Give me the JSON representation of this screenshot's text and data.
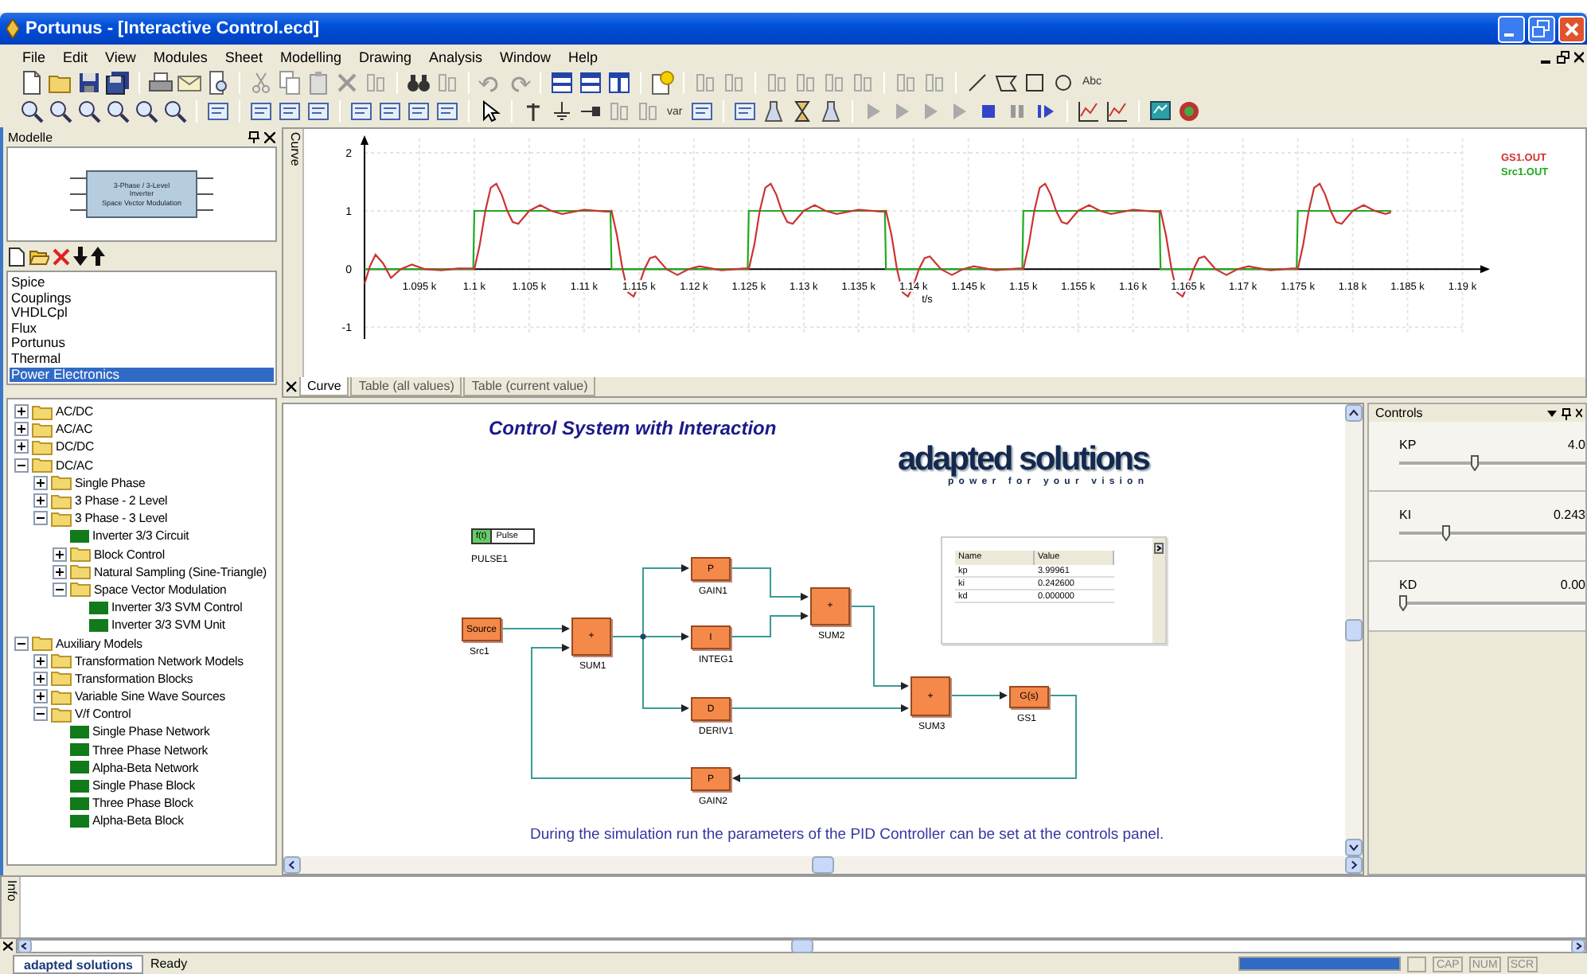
{
  "window": {
    "title": "Portunus - [Interactive Control.ecd]"
  },
  "menu": [
    "File",
    "Edit",
    "View",
    "Modules",
    "Sheet",
    "Modelling",
    "Drawing",
    "Analysis",
    "Window",
    "Help"
  ],
  "toolbar_texts": [
    "Abc",
    "var"
  ],
  "models_panel": {
    "title": "Modelle",
    "preview_lines": [
      "3-Phase / 3-Level",
      "Inverter",
      "Space Vector Modulation"
    ],
    "libraries": [
      {
        "label": "Spice",
        "selected": false
      },
      {
        "label": "Couplings",
        "selected": false
      },
      {
        "label": "VHDLCpl",
        "selected": false
      },
      {
        "label": "Flux",
        "selected": false
      },
      {
        "label": "Portunus",
        "selected": false
      },
      {
        "label": "Thermal",
        "selected": false
      },
      {
        "label": "Power Electronics",
        "selected": true
      }
    ]
  },
  "tree": [
    {
      "label": "AC/DC",
      "kind": "folder",
      "expanded": false
    },
    {
      "label": "AC/AC",
      "kind": "folder",
      "expanded": false
    },
    {
      "label": "DC/DC",
      "kind": "folder",
      "expanded": false
    },
    {
      "label": "DC/AC",
      "kind": "folder",
      "expanded": true,
      "children": [
        {
          "label": "Single Phase",
          "kind": "folder",
          "expanded": false
        },
        {
          "label": "3 Phase - 2 Level",
          "kind": "folder",
          "expanded": false
        },
        {
          "label": "3 Phase - 3 Level",
          "kind": "folder",
          "expanded": true,
          "children": [
            {
              "label": "Inverter 3/3 Circuit",
              "kind": "model"
            },
            {
              "label": "Block Control",
              "kind": "folder",
              "expanded": false
            },
            {
              "label": "Natural Sampling (Sine-Triangle)",
              "kind": "folder",
              "expanded": false
            },
            {
              "label": "Space Vector Modulation",
              "kind": "folder",
              "expanded": true,
              "children": [
                {
                  "label": "Inverter 3/3 SVM Control",
                  "kind": "model"
                },
                {
                  "label": "Inverter 3/3 SVM Unit",
                  "kind": "model"
                }
              ]
            }
          ]
        }
      ]
    },
    {
      "label": "Auxiliary Models",
      "kind": "folder",
      "expanded": true,
      "children": [
        {
          "label": "Transformation Network Models",
          "kind": "folder",
          "expanded": false
        },
        {
          "label": "Transformation Blocks",
          "kind": "folder",
          "expanded": false
        },
        {
          "label": "Variable Sine Wave Sources",
          "kind": "folder",
          "expanded": false
        },
        {
          "label": "V/f Control",
          "kind": "folder",
          "expanded": true,
          "children": [
            {
              "label": "Single Phase Network",
              "kind": "model"
            },
            {
              "label": "Three Phase Network",
              "kind": "model"
            },
            {
              "label": "Alpha-Beta Network",
              "kind": "model"
            },
            {
              "label": "Single Phase Block",
              "kind": "model"
            },
            {
              "label": "Three Phase Block",
              "kind": "model"
            },
            {
              "label": "Alpha-Beta Block",
              "kind": "model"
            }
          ]
        }
      ]
    }
  ],
  "curve_panel": {
    "side_label": "Curve",
    "chart_data": {
      "type": "line",
      "grid": true,
      "xlabel": "t/s",
      "xlim": [
        1.09,
        1.1925
      ],
      "ylim": [
        -1.2,
        2.3
      ],
      "xticks": [
        {
          "value": 1.095,
          "label": "1.095 k"
        },
        {
          "value": 1.1,
          "label": "1.1 k"
        },
        {
          "value": 1.105,
          "label": "1.105 k"
        },
        {
          "value": 1.11,
          "label": "1.11 k"
        },
        {
          "value": 1.115,
          "label": "1.115 k"
        },
        {
          "value": 1.12,
          "label": "1.12 k"
        },
        {
          "value": 1.125,
          "label": "1.125 k"
        },
        {
          "value": 1.13,
          "label": "1.13 k"
        },
        {
          "value": 1.135,
          "label": "1.135 k"
        },
        {
          "value": 1.14,
          "label": "1.14 k"
        },
        {
          "value": 1.145,
          "label": "1.145 k"
        },
        {
          "value": 1.15,
          "label": "1.15 k"
        },
        {
          "value": 1.155,
          "label": "1.155 k"
        },
        {
          "value": 1.16,
          "label": "1.16 k"
        },
        {
          "value": 1.165,
          "label": "1.165 k"
        },
        {
          "value": 1.17,
          "label": "1.17 k"
        },
        {
          "value": 1.175,
          "label": "1.175 k"
        },
        {
          "value": 1.18,
          "label": "1.18 k"
        },
        {
          "value": 1.185,
          "label": "1.185 k"
        },
        {
          "value": 1.19,
          "label": "1.19 k"
        }
      ],
      "yticks": [
        -1,
        0,
        1,
        2
      ],
      "x": [
        1.09,
        1.0905,
        1.091,
        1.0917,
        1.0924,
        1.0933,
        1.0943,
        1.0955,
        1.097,
        1.0985,
        1.0999,
        1.1,
        1.1005,
        1.101,
        1.1015,
        1.102,
        1.1025,
        1.103,
        1.1035,
        1.104,
        1.105,
        1.106,
        1.107,
        1.108,
        1.11,
        1.112,
        1.1124,
        1.1125,
        1.113,
        1.1135,
        1.114,
        1.1145,
        1.115,
        1.1155,
        1.116,
        1.1165,
        1.1175,
        1.1185,
        1.1195,
        1.1205,
        1.1225,
        1.1245,
        1.1249,
        1.125,
        1.1255,
        1.126,
        1.1265,
        1.127,
        1.1275,
        1.128,
        1.1285,
        1.129,
        1.13,
        1.131,
        1.132,
        1.133,
        1.135,
        1.137,
        1.1374,
        1.1375,
        1.138,
        1.1385,
        1.139,
        1.1395,
        1.14,
        1.1405,
        1.141,
        1.1415,
        1.1425,
        1.1435,
        1.1445,
        1.1455,
        1.1475,
        1.1495,
        1.1499,
        1.15,
        1.1505,
        1.151,
        1.1515,
        1.152,
        1.1525,
        1.153,
        1.1535,
        1.154,
        1.155,
        1.156,
        1.157,
        1.158,
        1.16,
        1.162,
        1.1624,
        1.1625,
        1.163,
        1.1635,
        1.164,
        1.1645,
        1.165,
        1.1655,
        1.166,
        1.1665,
        1.1675,
        1.1685,
        1.1695,
        1.1705,
        1.1725,
        1.1745,
        1.1749,
        1.175,
        1.1755,
        1.176,
        1.1765,
        1.177,
        1.1775,
        1.178,
        1.1785,
        1.179,
        1.18,
        1.181,
        1.182,
        1.183,
        1.1835
      ],
      "series": [
        {
          "name": "GS1.OUT",
          "color": "#cc3333",
          "values": [
            -0.25,
            0.05,
            0.25,
            0.1,
            -0.15,
            0,
            0.08,
            0,
            -0.02,
            0.01,
            0.01,
            0,
            0.42,
            1,
            1.4,
            1.47,
            1.28,
            1,
            0.81,
            0.78,
            1,
            1.1,
            1,
            0.95,
            1.02,
            0.99,
            0.99,
            1,
            0.58,
            0,
            -0.4,
            -0.47,
            -0.28,
            0,
            0.19,
            0.22,
            0,
            -0.1,
            0,
            0.05,
            -0.02,
            0.01,
            0.01,
            0,
            0.42,
            1,
            1.4,
            1.47,
            1.28,
            1,
            0.81,
            0.78,
            1,
            1.1,
            1,
            0.95,
            1.02,
            0.99,
            0.99,
            1,
            0.58,
            0,
            -0.4,
            -0.47,
            -0.28,
            0,
            0.19,
            0.22,
            0,
            -0.1,
            0,
            0.05,
            -0.02,
            0.01,
            0.01,
            0,
            0.42,
            1,
            1.4,
            1.47,
            1.28,
            1,
            0.81,
            0.78,
            1,
            1.1,
            1,
            0.95,
            1.02,
            0.99,
            0.99,
            1,
            0.58,
            0,
            -0.4,
            -0.47,
            -0.28,
            0,
            0.19,
            0.22,
            0,
            -0.1,
            0,
            0.05,
            -0.02,
            0.01,
            0.01,
            0,
            0.42,
            1,
            1.4,
            1.47,
            1.28,
            1,
            0.81,
            0.78,
            1,
            1.1,
            1,
            0.95,
            0.98
          ]
        },
        {
          "name": "Src1.OUT",
          "color": "#22aa22",
          "values": [
            0,
            0,
            0,
            0,
            0,
            0,
            0,
            0,
            0,
            0,
            0,
            1,
            1,
            1,
            1,
            1,
            1,
            1,
            1,
            1,
            1,
            1,
            1,
            1,
            1,
            1,
            1,
            0,
            0,
            0,
            0,
            0,
            0,
            0,
            0,
            0,
            0,
            0,
            0,
            0,
            0,
            0,
            0,
            1,
            1,
            1,
            1,
            1,
            1,
            1,
            1,
            1,
            1,
            1,
            1,
            1,
            1,
            1,
            1,
            0,
            0,
            0,
            0,
            0,
            0,
            0,
            0,
            0,
            0,
            0,
            0,
            0,
            0,
            0,
            0,
            1,
            1,
            1,
            1,
            1,
            1,
            1,
            1,
            1,
            1,
            1,
            1,
            1,
            1,
            1,
            1,
            0,
            0,
            0,
            0,
            0,
            0,
            0,
            0,
            0,
            0,
            0,
            0,
            0,
            0,
            0,
            0,
            1,
            1,
            1,
            1,
            1,
            1,
            1,
            1,
            1,
            1,
            1,
            1,
            1,
            1
          ]
        }
      ]
    },
    "tabs": [
      {
        "label": "Curve",
        "selected": true
      },
      {
        "label": "Table (all values)",
        "selected": false
      },
      {
        "label": "Table (current value)",
        "selected": false
      }
    ]
  },
  "diagram": {
    "title": "Control System with Interaction",
    "logo": {
      "name": "adapted solutions",
      "tagline": "power for your vision"
    },
    "pulse": {
      "symbol": "f(t)",
      "label": "Pulse",
      "name": "PULSE1"
    },
    "blocks": [
      {
        "symbol": "Source",
        "name": "Src1"
      },
      {
        "symbol": "+",
        "name": "SUM1"
      },
      {
        "symbol": "P",
        "name": "GAIN1"
      },
      {
        "symbol": "I",
        "name": "INTEG1"
      },
      {
        "symbol": "D",
        "name": "DERIV1"
      },
      {
        "symbol": "+",
        "name": "SUM2"
      },
      {
        "symbol": "+",
        "name": "SUM3"
      },
      {
        "symbol": "G(s)",
        "name": "GS1"
      },
      {
        "symbol": "P",
        "name": "GAIN2"
      }
    ],
    "table": {
      "columns": [
        "Name",
        "Value"
      ],
      "rows": [
        [
          "kp",
          "3.99961"
        ],
        [
          "ki",
          "0.242600"
        ],
        [
          "kd",
          "0.000000"
        ]
      ]
    },
    "caption": "During the simulation run the parameters of the PID Controller can be set at the controls panel."
  },
  "controls": {
    "title": "Controls",
    "sliders": [
      {
        "label": "KP",
        "reading": "4.0",
        "level": 0.4
      },
      {
        "label": "KI",
        "reading": "0.243",
        "level": 0.25
      },
      {
        "label": "KD",
        "reading": "0.00",
        "level": 0.02
      }
    ]
  },
  "info_panel": {
    "side_label": "Info"
  },
  "status_bar": {
    "tab": "adapted solutions",
    "message": "Ready",
    "progress": {
      "level": 1
    },
    "indicators": [
      "CAP",
      "NUM",
      "SCR"
    ]
  }
}
